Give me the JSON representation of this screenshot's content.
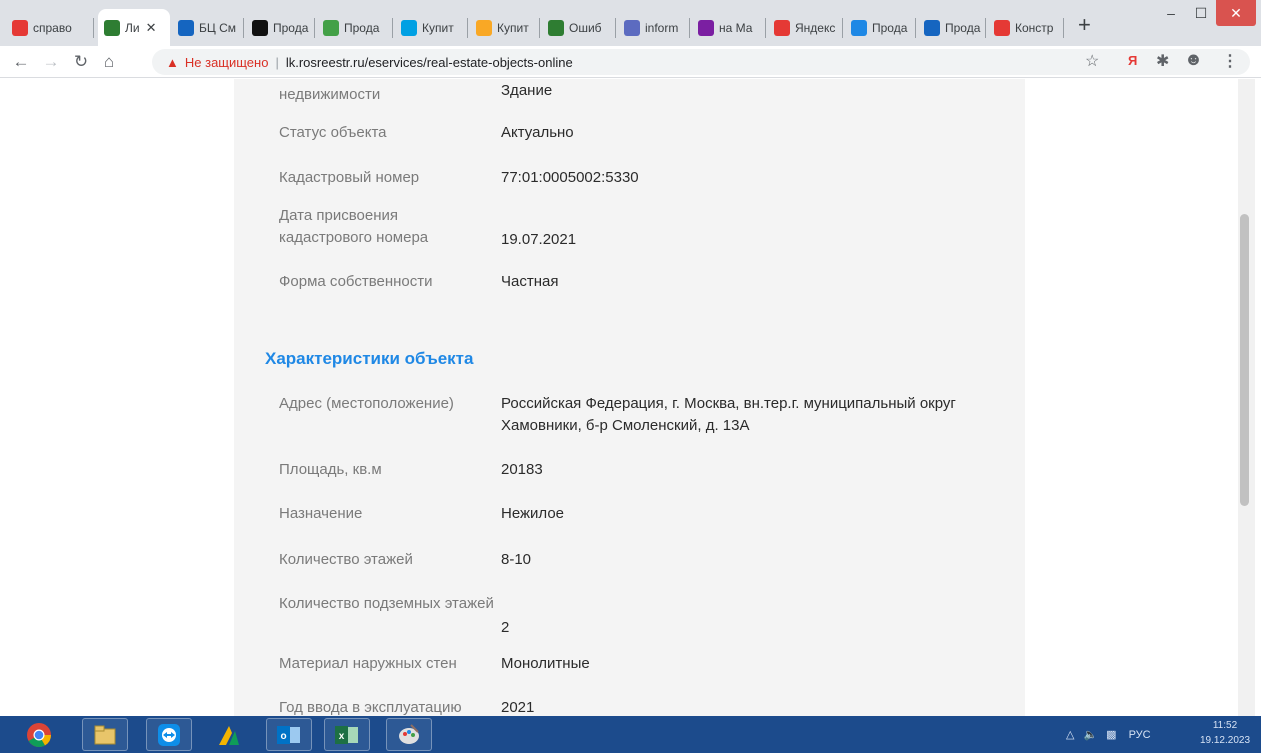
{
  "browser": {
    "tabs": [
      {
        "title": "справо",
        "icon": "yandex-icon",
        "color": "#e53935"
      },
      {
        "title": "Ли",
        "icon": "rosreestr-icon",
        "color": "#2e7d32"
      },
      {
        "title": "БЦ См",
        "icon": "arrow-logo-icon",
        "color": "#1565c0"
      },
      {
        "title": "Прода",
        "icon": "an-logo-icon",
        "color": "#111111"
      },
      {
        "title": "Прода",
        "icon": "domclick-icon",
        "color": "#43a047"
      },
      {
        "title": "Купит",
        "icon": "cian-icon",
        "color": "#00a0e3"
      },
      {
        "title": "Купит",
        "icon": "yellow-house-icon",
        "color": "#f9a825"
      },
      {
        "title": "Ошиб",
        "icon": "rosreestr-icon",
        "color": "#2e7d32"
      },
      {
        "title": "inform",
        "icon": "n-logo-icon",
        "color": "#5c6bc0"
      },
      {
        "title": "на Ма",
        "icon": "sp-logo-icon",
        "color": "#7b1fa2"
      },
      {
        "title": "Яндекс",
        "icon": "location-pin-icon",
        "color": "#e53935"
      },
      {
        "title": "Прода",
        "icon": "ta-logo-icon",
        "color": "#1e88e5"
      },
      {
        "title": "Прода",
        "icon": "arrow-logo-icon",
        "color": "#1565c0"
      },
      {
        "title": "Констр",
        "icon": "pin-yellow-icon",
        "color": "#e53935"
      }
    ],
    "not_secure_label": "Не защищено",
    "url": "lk.rosreestr.ru/eservices/real-estate-objects-online"
  },
  "object": {
    "rows_top": [
      {
        "label": "недвижимости",
        "value": "Здание"
      },
      {
        "label": "Статус объекта",
        "value": "Актуально"
      },
      {
        "label": "Кадастровый номер",
        "value": "77:01:0005002:5330"
      },
      {
        "label": "Дата присвоения кадастрового номера",
        "value": "19.07.2021"
      },
      {
        "label": "Форма собственности",
        "value": "Частная"
      }
    ],
    "section_title": "Характеристики объекта",
    "rows_characteristics": [
      {
        "label": "Адрес (местоположение)",
        "value": "Российская Федерация, г. Москва, вн.тер.г. муниципальный округ Хамовники, б-р Смоленский, д. 13А"
      },
      {
        "label": "Площадь, кв.м",
        "value": "20183"
      },
      {
        "label": "Назначение",
        "value": "Нежилое"
      },
      {
        "label": "Количество этажей",
        "value": "8-10"
      },
      {
        "label": "Количество подземных этажей",
        "value": "2"
      },
      {
        "label": "Материал наружных стен",
        "value": "Монолитные"
      },
      {
        "label": "Год ввода в эксплуатацию",
        "value": "2021"
      }
    ]
  },
  "taskbar": {
    "tray_lang": "РУС",
    "time": "11:52",
    "date": "19.12.2023"
  }
}
